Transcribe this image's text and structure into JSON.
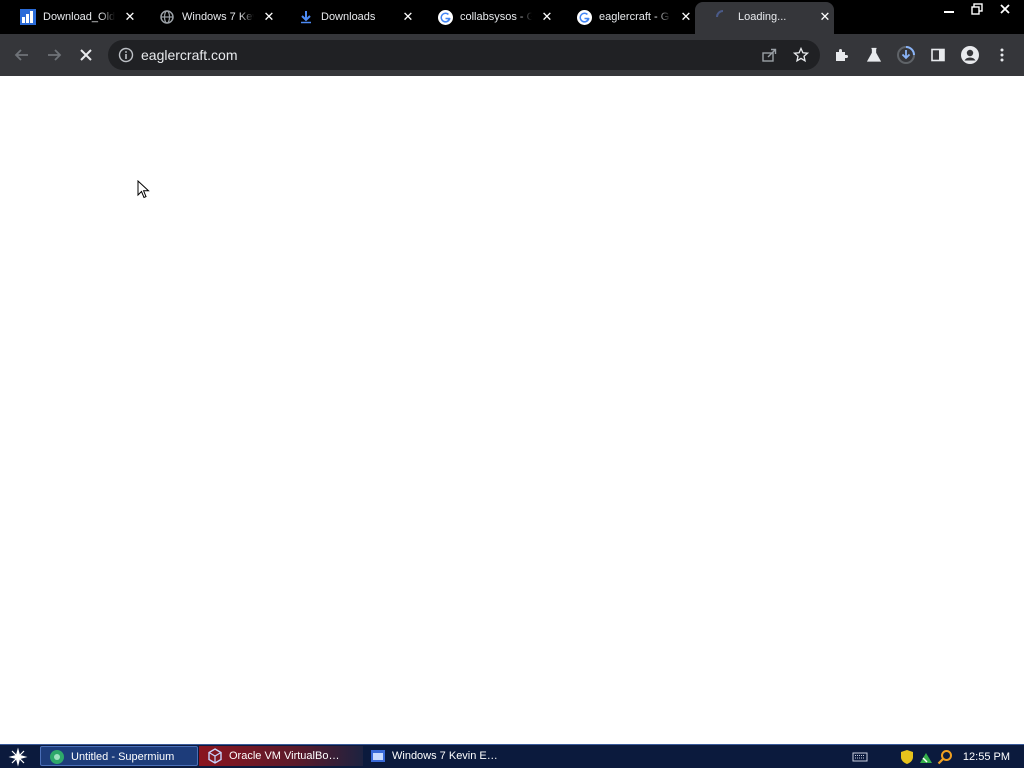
{
  "tabs": [
    {
      "title": "Download_Old",
      "icon": "oldversion-icon"
    },
    {
      "title": "Windows 7 Kev",
      "icon": "globe-icon"
    },
    {
      "title": "Downloads",
      "icon": "download-icon"
    },
    {
      "title": "collabsysos - G",
      "icon": "google-icon"
    },
    {
      "title": "eaglercraft - G",
      "icon": "google-icon"
    },
    {
      "title": "Loading...",
      "icon": "loading-spinner-icon",
      "active": true
    }
  ],
  "tab_close_glyph": "✕",
  "omnibox": {
    "url": "eaglercraft.com"
  },
  "taskbar": {
    "items": [
      {
        "label": "Untitled - Supermium",
        "active": true
      },
      {
        "label": "Oracle VM VirtualBo…"
      },
      {
        "label": "Windows 7 Kevin E…"
      }
    ],
    "clock": "12:55 PM"
  },
  "colors": {
    "tabstrip_bg": "#000000",
    "toolbar_bg": "#35363a",
    "omnibox_bg": "#202124",
    "taskbar_bg": "#0b1a3d",
    "accent_blue": "#8ab4f8"
  }
}
